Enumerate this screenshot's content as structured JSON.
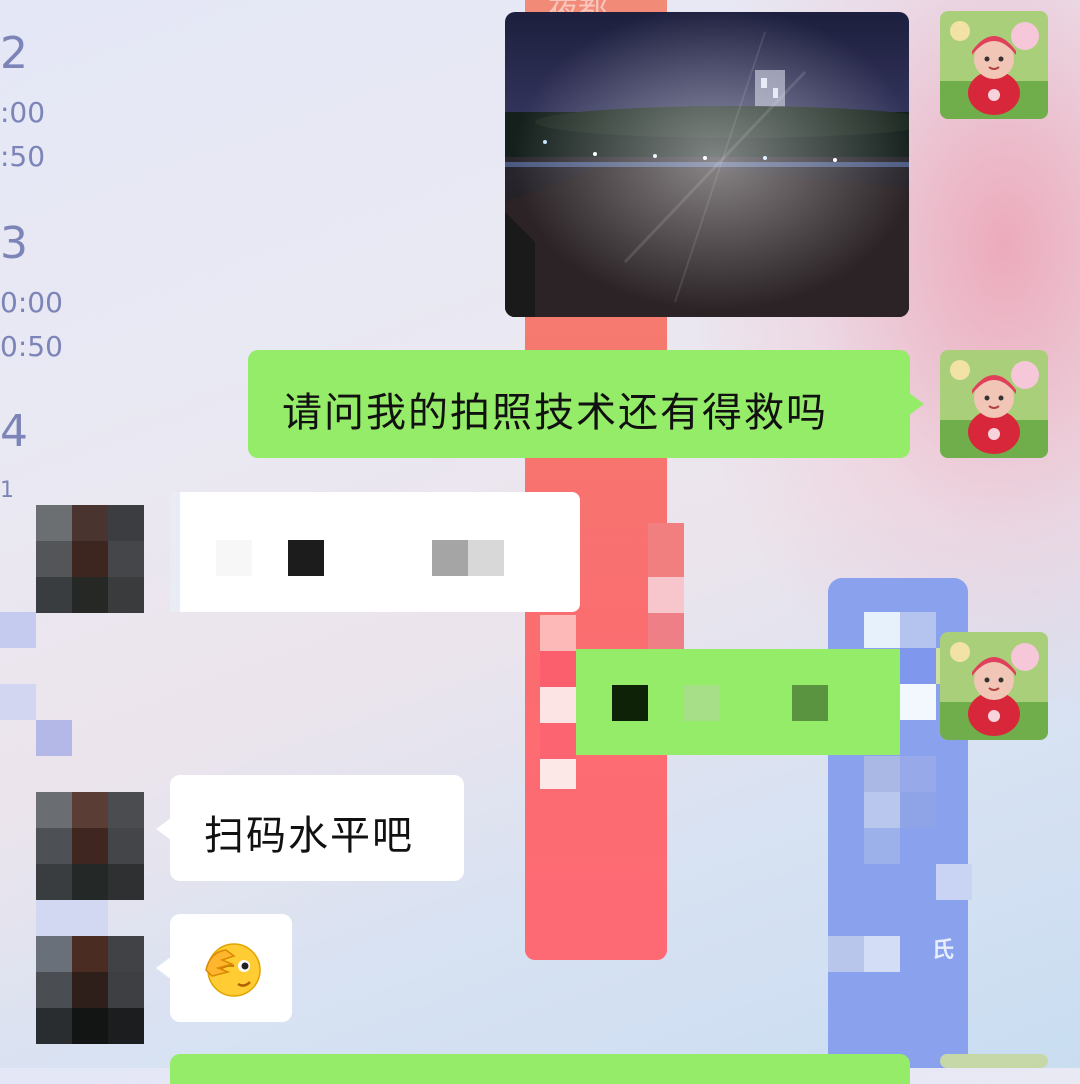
{
  "background": {
    "pillar_text": "夜都",
    "blue_mark": "氏"
  },
  "timetable": [
    {
      "day": "2",
      "times": [
        ":00",
        ":50"
      ]
    },
    {
      "day": "3",
      "times": [
        "0:00",
        "0:50"
      ]
    },
    {
      "day": "4",
      "times": [
        "1"
      ]
    }
  ],
  "messages": [
    {
      "side": "right",
      "type": "image",
      "description": "night-photo"
    },
    {
      "side": "right",
      "type": "text",
      "text": "请问我的拍照技术还有得救吗"
    },
    {
      "side": "left",
      "type": "pixelated"
    },
    {
      "side": "right",
      "type": "pixelated"
    },
    {
      "side": "left",
      "type": "text",
      "text": "扫码水平吧"
    },
    {
      "side": "left",
      "type": "emoji",
      "emoji": "🫣"
    },
    {
      "side": "right",
      "type": "partial"
    }
  ],
  "colors": {
    "self_bubble": "#95ec69",
    "other_bubble": "#ffffff",
    "timetable_text": "#7c84b8"
  }
}
